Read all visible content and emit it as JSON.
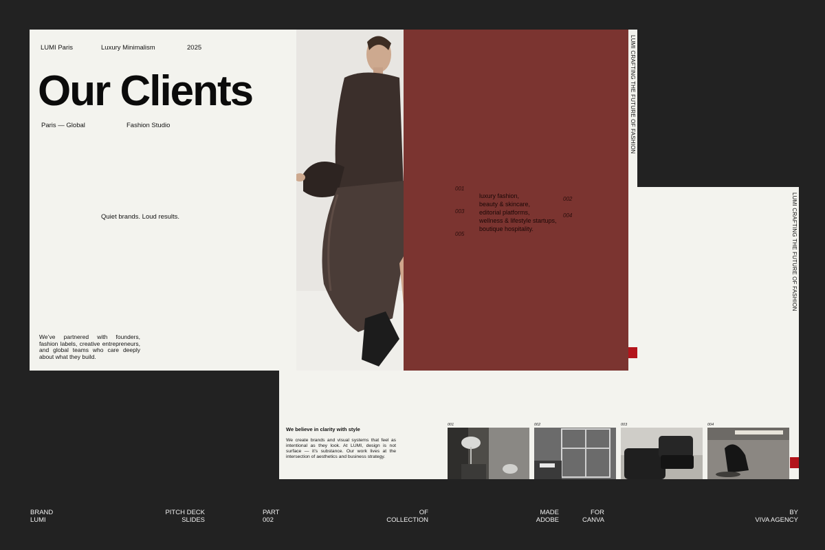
{
  "front_slide": {
    "brand": "LUMI Paris",
    "style": "Luxury Minimalism",
    "year": "2025",
    "title": "Our Clients",
    "location": "Paris — Global",
    "studio": "Fashion Studio",
    "tagline": "Quiet brands. Loud results.",
    "intro": "We’ve partnered with founders, fashion labels, creative entrepreneurs, and global teams who care deeply about what they build.",
    "numbers": [
      "001",
      "002",
      "003",
      "004",
      "005"
    ],
    "client_list": [
      "luxury fashion,",
      "beauty & skincare,",
      "editorial platforms,",
      "wellness & lifestyle startups,",
      "boutique hospitality."
    ],
    "vertical_text": "LUMI CRAFTING THE FUTURE OF FASHION"
  },
  "back_slide": {
    "vertical_text": "LUMI CRAFTING THE FUTURE OF FASHION",
    "heading": "We believe in clarity with style",
    "paragraph": "We create brands and visual systems that feel as intentional as they look. At LUMI, design is not surface — it’s substance. Our work lives at the intersection of aesthetics and business strategy.",
    "thumb_numbers": [
      "001",
      "002",
      "003",
      "004"
    ]
  },
  "footer": {
    "brand_l1": "BRAND",
    "brand_l2": "LUMI",
    "pitch_l1": "PITCH DECK",
    "pitch_l2": "SLIDES",
    "part_l1": "PART",
    "part_l2": "002",
    "of_l1": "OF",
    "of_l2": "COLLECTION",
    "made_l1": "MADE",
    "made_l2": "ADOBE",
    "for_l1": "FOR",
    "for_l2": "CANVA",
    "by_l1": "BY",
    "by_l2": "VIVA AGENCY"
  },
  "colors": {
    "background": "#222222",
    "paper": "#f3f3ee",
    "wine": "#7b3430",
    "accent_red": "#b3141b"
  }
}
